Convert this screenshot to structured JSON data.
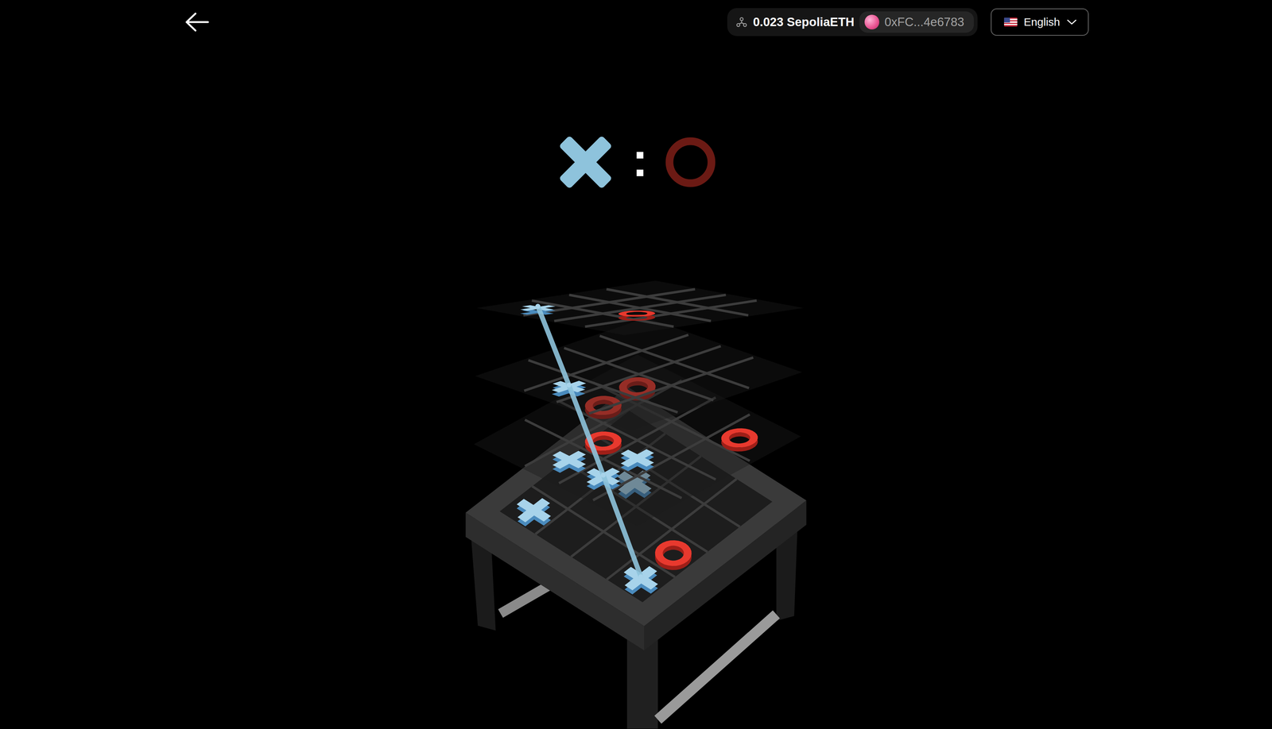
{
  "wallet": {
    "balance": "0.023 SepoliaETH",
    "address": "0xFC...4e6783"
  },
  "language": {
    "label": "English"
  },
  "score": {
    "players": [
      {
        "kind": "x",
        "active": true
      },
      {
        "kind": "o",
        "active": false
      }
    ],
    "separator": ":"
  },
  "board": {
    "layers": [
      {
        "cells": [
          [
            "x",
            "",
            "",
            ""
          ],
          [
            "",
            "",
            "",
            ""
          ],
          [
            "",
            "o",
            "",
            ""
          ],
          [
            "",
            "",
            "",
            ""
          ]
        ]
      },
      {
        "cells": [
          [
            "",
            "",
            "",
            ""
          ],
          [
            "x",
            "",
            "",
            ""
          ],
          [
            "",
            "",
            "",
            ""
          ],
          [
            "",
            "",
            "",
            ""
          ]
        ]
      },
      {
        "cells": [
          [
            "",
            "",
            "o",
            "o"
          ],
          [
            "x",
            "o",
            "",
            ""
          ],
          [
            "x",
            "x",
            "",
            ""
          ],
          [
            "",
            "",
            "",
            "o"
          ]
        ]
      },
      {
        "cells": [
          [
            "x",
            "",
            "",
            ""
          ],
          [
            "",
            "",
            "x",
            ""
          ],
          [
            "",
            "",
            "",
            ""
          ],
          [
            "x",
            "o",
            "",
            ""
          ]
        ]
      }
    ],
    "winning_line": [
      [
        0,
        0,
        0
      ],
      [
        1,
        1,
        0
      ],
      [
        2,
        2,
        0
      ],
      [
        3,
        3,
        0
      ]
    ]
  }
}
